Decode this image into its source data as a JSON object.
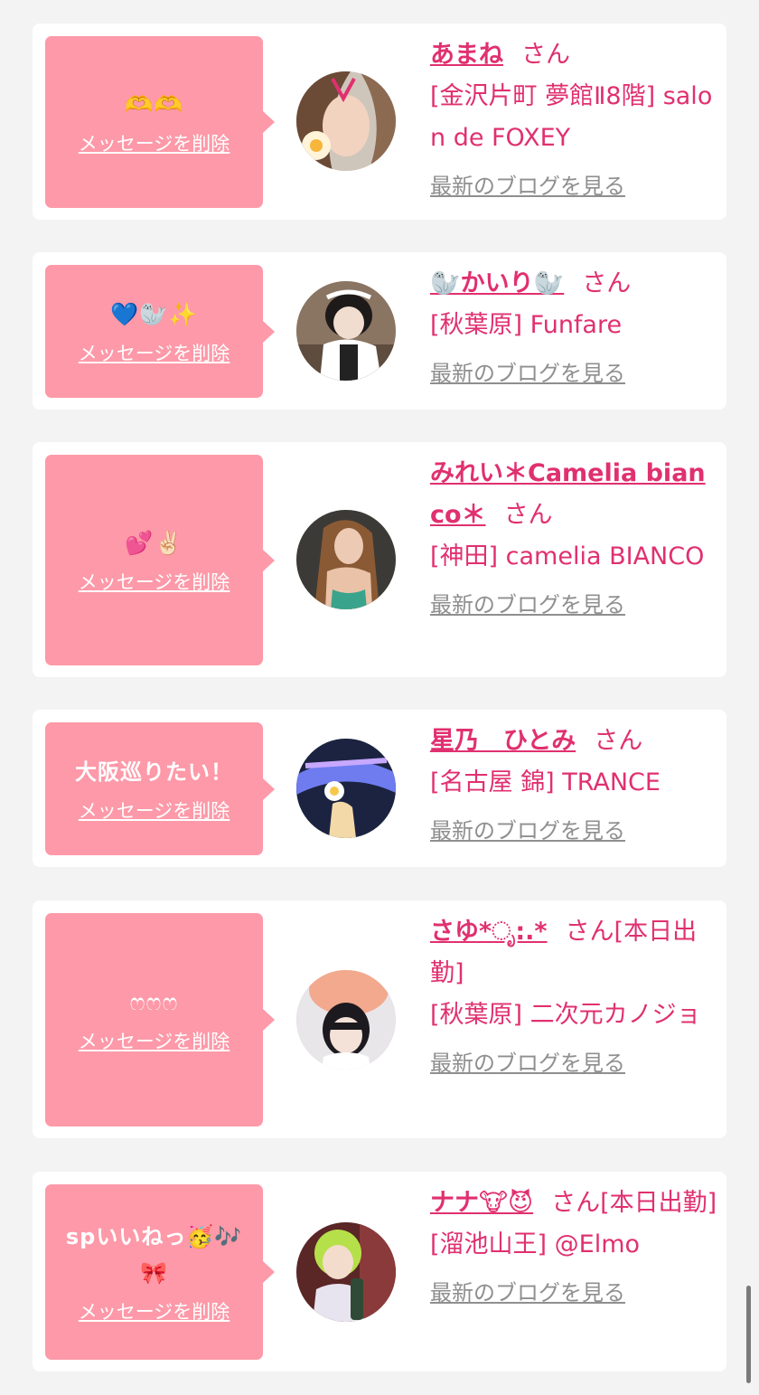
{
  "colors": {
    "page_bg": "#f3f3f3",
    "card_bg": "#ffffff",
    "bubble_bg": "#fd99a8",
    "accent": "#e0306f",
    "link_gray": "#8f8f8f"
  },
  "cards": [
    {
      "message": "🫶🫶",
      "delete_label": "メッセージを削除",
      "name": "あまね",
      "suffix": "さん",
      "shop": "[金沢片町 夢館Ⅱ8階] salon de FOXEY",
      "blog_label": "最新のブログを見る"
    },
    {
      "message": "💙🦭✨",
      "delete_label": "メッセージを削除",
      "name": "🦭かいり🦭",
      "suffix": "さん",
      "shop": "[秋葉原] Funfare",
      "blog_label": "最新のブログを見る"
    },
    {
      "message": "💕✌🏻",
      "delete_label": "メッセージを削除",
      "name": "みれい＊Camelia bianco＊",
      "suffix": "さん",
      "shop": "[神田] camelia BIANCO",
      "blog_label": "最新のブログを見る"
    },
    {
      "message": "大阪巡りたい！",
      "delete_label": "メッセージを削除",
      "name": "星乃　ひとみ",
      "suffix": "さん",
      "shop": "[名古屋 錦] TRANCE",
      "blog_label": "最新のブログを見る"
    },
    {
      "message": "ෆෆෆ",
      "delete_label": "メッセージを削除",
      "name": "さゆ*ೃ:.*",
      "suffix": "さん[本日出勤]",
      "shop": "[秋葉原] 二次元カノジョ",
      "blog_label": "最新のブログを見る"
    },
    {
      "message": "spいいねっ🥳🎶🎀",
      "delete_label": "メッセージを削除",
      "name": "ナナ🐮😈",
      "suffix": "さん[本日出勤]",
      "shop": "[溜池山王] @Elmo",
      "blog_label": "最新のブログを見る"
    }
  ]
}
